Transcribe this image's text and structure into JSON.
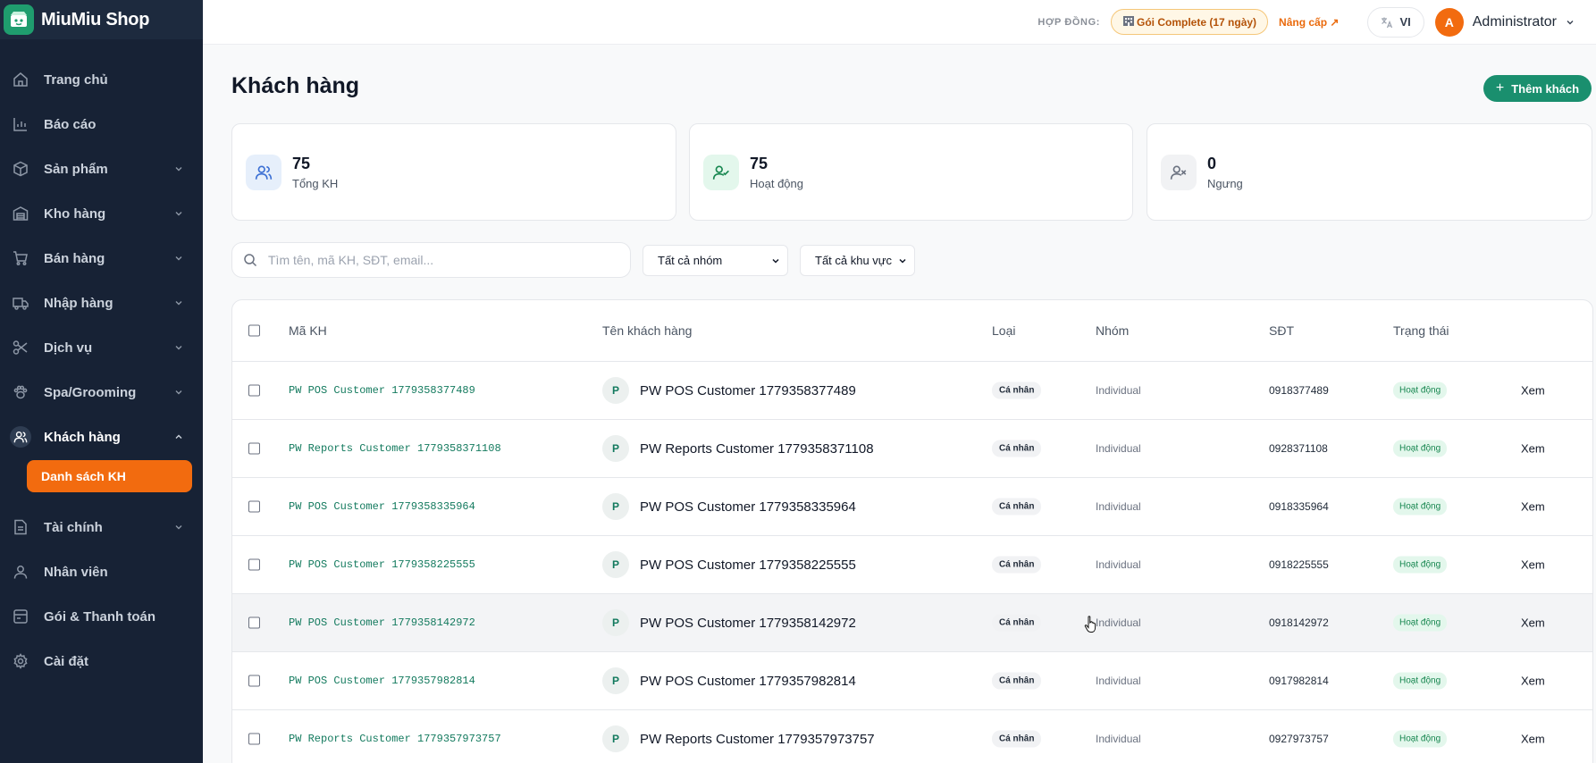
{
  "brand": {
    "name": "MiuMiu Shop"
  },
  "sidebar": {
    "items": [
      {
        "label": "Trang chủ",
        "icon": "home-icon",
        "chevron": false
      },
      {
        "label": "Báo cáo",
        "icon": "chart-icon",
        "chevron": false
      },
      {
        "label": "Sản phẩm",
        "icon": "box-icon",
        "chevron": true
      },
      {
        "label": "Kho hàng",
        "icon": "warehouse-icon",
        "chevron": true
      },
      {
        "label": "Bán hàng",
        "icon": "cart-icon",
        "chevron": true
      },
      {
        "label": "Nhập hàng",
        "icon": "truck-icon",
        "chevron": true
      },
      {
        "label": "Dịch vụ",
        "icon": "scissors-icon",
        "chevron": true
      },
      {
        "label": "Spa/Grooming",
        "icon": "paw-icon",
        "chevron": true
      },
      {
        "label": "Khách hàng",
        "icon": "users-icon",
        "chevron": true,
        "active": true
      },
      {
        "label": "Tài chính",
        "icon": "document-icon",
        "chevron": true
      },
      {
        "label": "Nhân viên",
        "icon": "user-icon",
        "chevron": false
      },
      {
        "label": "Gói & Thanh toán",
        "icon": "card-icon",
        "chevron": false
      },
      {
        "label": "Cài đặt",
        "icon": "gear-icon",
        "chevron": false
      }
    ],
    "subitem": "Danh sách KH"
  },
  "topbar": {
    "contract_label": "HỢP ĐỒNG:",
    "plan": "Gói Complete (17 ngày)",
    "upgrade": "Nâng cấp ↗",
    "lang": "VI",
    "avatar_initial": "A",
    "user": "Administrator"
  },
  "page": {
    "title": "Khách hàng",
    "add_button": "Thêm khách"
  },
  "stats": [
    {
      "value": "75",
      "label": "Tổng KH",
      "icon": "users-icon"
    },
    {
      "value": "75",
      "label": "Hoạt động",
      "icon": "user-check-icon"
    },
    {
      "value": "0",
      "label": "Ngưng",
      "icon": "user-x-icon"
    }
  ],
  "filters": {
    "search_placeholder": "Tìm tên, mã KH, SĐT, email...",
    "group": "Tất cả nhóm",
    "region": "Tất cả khu vực"
  },
  "table": {
    "headers": {
      "code": "Mã KH",
      "name": "Tên khách hàng",
      "type": "Loại",
      "group": "Nhóm",
      "phone": "SĐT",
      "status": "Trạng thái"
    },
    "rows": [
      {
        "code": "PW POS Customer 1779358377489",
        "initial": "P",
        "name": "PW POS Customer 1779358377489",
        "type": "Cá nhân",
        "group": "Individual",
        "phone": "0918377489",
        "status": "Hoạt động",
        "action": "Xem"
      },
      {
        "code": "PW Reports Customer 1779358371108",
        "initial": "P",
        "name": "PW Reports Customer 1779358371108",
        "type": "Cá nhân",
        "group": "Individual",
        "phone": "0928371108",
        "status": "Hoạt động",
        "action": "Xem"
      },
      {
        "code": "PW POS Customer 1779358335964",
        "initial": "P",
        "name": "PW POS Customer 1779358335964",
        "type": "Cá nhân",
        "group": "Individual",
        "phone": "0918335964",
        "status": "Hoạt động",
        "action": "Xem"
      },
      {
        "code": "PW POS Customer 1779358225555",
        "initial": "P",
        "name": "PW POS Customer 1779358225555",
        "type": "Cá nhân",
        "group": "Individual",
        "phone": "0918225555",
        "status": "Hoạt động",
        "action": "Xem"
      },
      {
        "code": "PW POS Customer 1779358142972",
        "initial": "P",
        "name": "PW POS Customer 1779358142972",
        "type": "Cá nhân",
        "group": "Individual",
        "phone": "0918142972",
        "status": "Hoạt động",
        "action": "Xem"
      },
      {
        "code": "PW POS Customer 1779357982814",
        "initial": "P",
        "name": "PW POS Customer 1779357982814",
        "type": "Cá nhân",
        "group": "Individual",
        "phone": "0917982814",
        "status": "Hoạt động",
        "action": "Xem"
      },
      {
        "code": "PW Reports Customer 1779357973757",
        "initial": "P",
        "name": "PW Reports Customer 1779357973757",
        "type": "Cá nhân",
        "group": "Individual",
        "phone": "0927973757",
        "status": "Hoạt động",
        "action": "Xem"
      }
    ]
  },
  "colors": {
    "accent": "#1a8f6e",
    "brand_orange": "#f26b0f",
    "sidebar_bg": "#172235"
  }
}
